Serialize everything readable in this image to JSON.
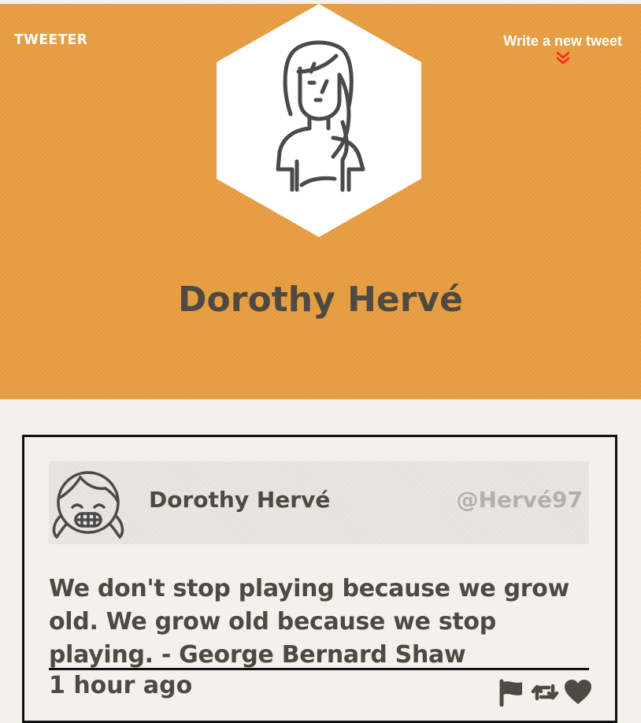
{
  "brand": "TWEETER",
  "nav": {
    "write_label": "Write a new tweet",
    "write_arrow_icon": "double-chevron-down-icon"
  },
  "profile": {
    "name": "Dorothy Hervé",
    "avatar_icon": "woman-avatar-icon"
  },
  "tweet": {
    "author": "Dorothy Hervé",
    "handle": "@Hervé97",
    "avatar_icon": "girl-avatar-icon",
    "text": "We don't stop playing because we grow old. We grow old because we stop playing. - George Bernard Shaw",
    "time": "1 hour ago",
    "actions": [
      "flag-icon",
      "retweet-icon",
      "heart-icon"
    ]
  },
  "colors": {
    "header_bg": "#e89e42",
    "page_bg": "#f4f1ec",
    "text_dark": "#4e4a41",
    "handle_gray": "#b4b0a9",
    "arrow_red": "#ff2a1a",
    "border": "#111111"
  }
}
